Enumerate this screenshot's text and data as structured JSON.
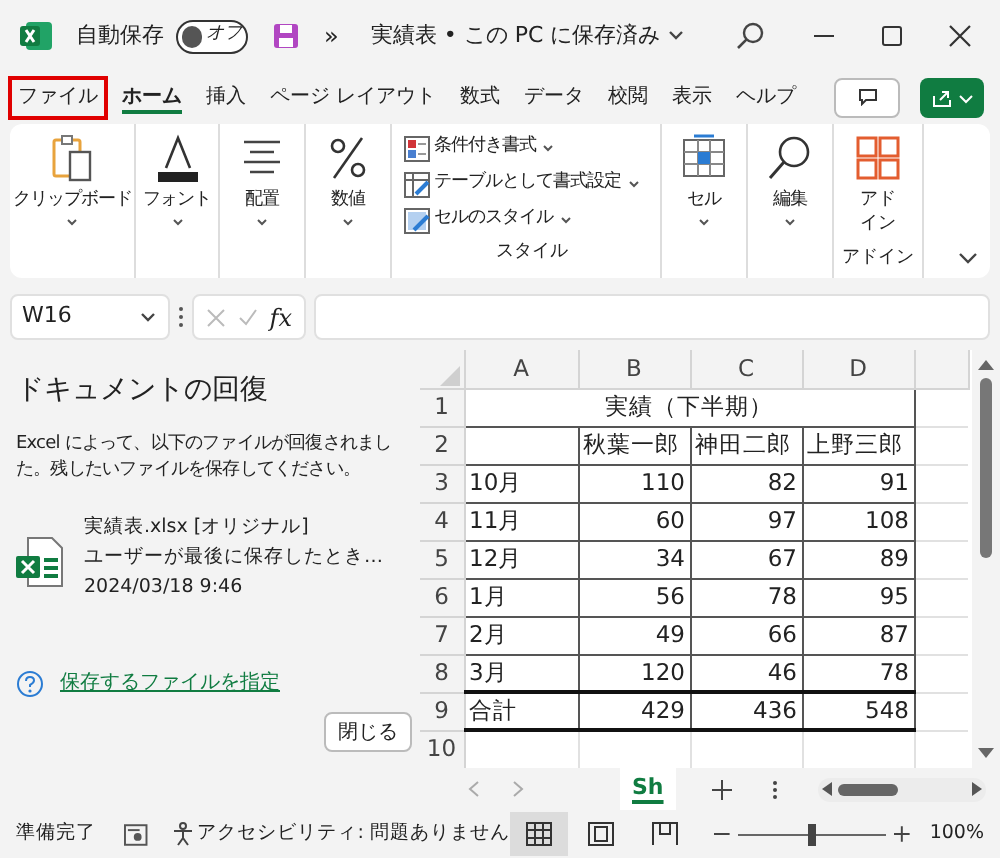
{
  "titlebar": {
    "autosave_label": "自動保存",
    "autosave": {
      "on": false,
      "label": "オフ"
    },
    "more": "»",
    "title": "実績表 • この PC に保存済み"
  },
  "tabs": [
    {
      "label": "ファイル",
      "selected": false,
      "highlighted": true
    },
    {
      "label": "ホーム",
      "selected": true,
      "highlighted": false
    },
    {
      "label": "挿入",
      "selected": false,
      "highlighted": false
    },
    {
      "label": "ページ レイアウト",
      "selected": false,
      "highlighted": false
    },
    {
      "label": "数式",
      "selected": false,
      "highlighted": false
    },
    {
      "label": "データ",
      "selected": false,
      "highlighted": false
    },
    {
      "label": "校閲",
      "selected": false,
      "highlighted": false
    },
    {
      "label": "表示",
      "selected": false,
      "highlighted": false
    },
    {
      "label": "ヘルプ",
      "selected": false,
      "highlighted": false
    }
  ],
  "ribbon": {
    "clipboard": "クリップボード",
    "font": "フォント",
    "alignment": "配置",
    "number": "数値",
    "styles": {
      "items": [
        "条件付き書式",
        "テーブルとして書式設定",
        "セルのスタイル"
      ],
      "group_label": "スタイル"
    },
    "cells": "セル",
    "editing": "編集",
    "addins": {
      "button": "アドイン",
      "group_label": "アドイン"
    }
  },
  "formula_bar": {
    "name_box": "W16",
    "fx": "fx"
  },
  "recovery": {
    "title": "ドキュメントの回復",
    "message": "Excel によって、以下のファイルが回復されました。残したいファイルを保存してください。",
    "files": [
      {
        "name": "実績表.xlsx",
        "tag": "[オリジナル]",
        "description": "ユーザーが最後に保存したとき…",
        "date": "2024/03/18 9:46"
      }
    ],
    "help_link": "保存するファイルを指定",
    "close_button": "閉じる"
  },
  "sheet": {
    "columns": [
      "A",
      "B",
      "C",
      "D"
    ],
    "rows": [
      {
        "header": "1",
        "kind": "title",
        "cells": [
          {
            "text": "実績（下半期）",
            "colspan": 4
          }
        ]
      },
      {
        "header": "2",
        "kind": "names",
        "cells": [
          "",
          "秋葉一郎",
          "神田二郎",
          "上野三郎"
        ]
      },
      {
        "header": "3",
        "kind": "data",
        "cells": [
          "10月",
          "110",
          "82",
          "91"
        ]
      },
      {
        "header": "4",
        "kind": "data",
        "cells": [
          "11月",
          "60",
          "97",
          "108"
        ]
      },
      {
        "header": "5",
        "kind": "data",
        "cells": [
          "12月",
          "34",
          "67",
          "89"
        ]
      },
      {
        "header": "6",
        "kind": "data",
        "cells": [
          "1月",
          "56",
          "78",
          "95"
        ]
      },
      {
        "header": "7",
        "kind": "data",
        "cells": [
          "2月",
          "49",
          "66",
          "87"
        ]
      },
      {
        "header": "8",
        "kind": "data",
        "cells": [
          "3月",
          "120",
          "46",
          "78"
        ]
      },
      {
        "header": "9",
        "kind": "total",
        "cells": [
          "合計",
          "429",
          "436",
          "548"
        ]
      },
      {
        "header": "10",
        "kind": "empty",
        "cells": []
      }
    ]
  },
  "sheet_tabs": [
    {
      "label": "Sh",
      "selected": true
    }
  ],
  "status_bar": {
    "ready": "準備完了",
    "accessibility": "アクセシビリティ: 問題ありません",
    "views": [
      {
        "selected": true
      },
      {
        "selected": false
      },
      {
        "selected": false
      }
    ],
    "zoom": {
      "level": 0.5,
      "reading": "100%"
    }
  }
}
